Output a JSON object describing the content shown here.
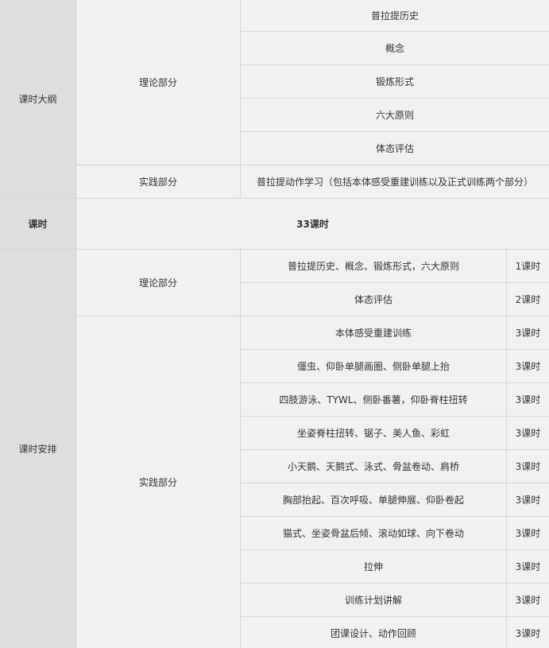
{
  "outline": {
    "label": "课时大纲",
    "theory_label": "理论部分",
    "theory_items": [
      "普拉提历史",
      "概念",
      "锻炼形式",
      "六大原则",
      "体态评估"
    ],
    "practice_label": "实践部分",
    "practice_item": "普拉提动作学习（包括本体感受重建训练以及正式训练两个部分）"
  },
  "hours": {
    "label": "课时",
    "value": "33课时"
  },
  "schedule": {
    "label": "课时安排",
    "theory_label": "理论部分",
    "theory_rows": [
      {
        "topic": "普拉提历史、概念、锻炼形式，六大原则",
        "hours": "1课时"
      },
      {
        "topic": "体态评估",
        "hours": "2课时"
      }
    ],
    "practice_label": "实践部分",
    "practice_rows": [
      {
        "topic": "本体感受重建训练",
        "hours": "3课时"
      },
      {
        "topic": "僵虫、仰卧单腿画圈、侧卧单腿上抬",
        "hours": "3课时"
      },
      {
        "topic": "四肢游泳、TYWL、侧卧番薯，仰卧脊柱扭转",
        "hours": "3课时"
      },
      {
        "topic": "坐姿脊柱扭转、锯子、美人鱼、彩虹",
        "hours": "3课时"
      },
      {
        "topic": "小天鹅、天鹅式、泳式、骨盆卷动、肩桥",
        "hours": "3课时"
      },
      {
        "topic": "胸部抬起、百次呼吸、单腿伸展、仰卧卷起",
        "hours": "3课时"
      },
      {
        "topic": "猫式、坐姿骨盆后倾、滚动如球、向下卷动",
        "hours": "3课时"
      },
      {
        "topic": "拉伸",
        "hours": "3课时"
      },
      {
        "topic": "训练计划讲解",
        "hours": "3课时"
      },
      {
        "topic": "团课设计、动作回顾",
        "hours": "3课时"
      }
    ]
  }
}
